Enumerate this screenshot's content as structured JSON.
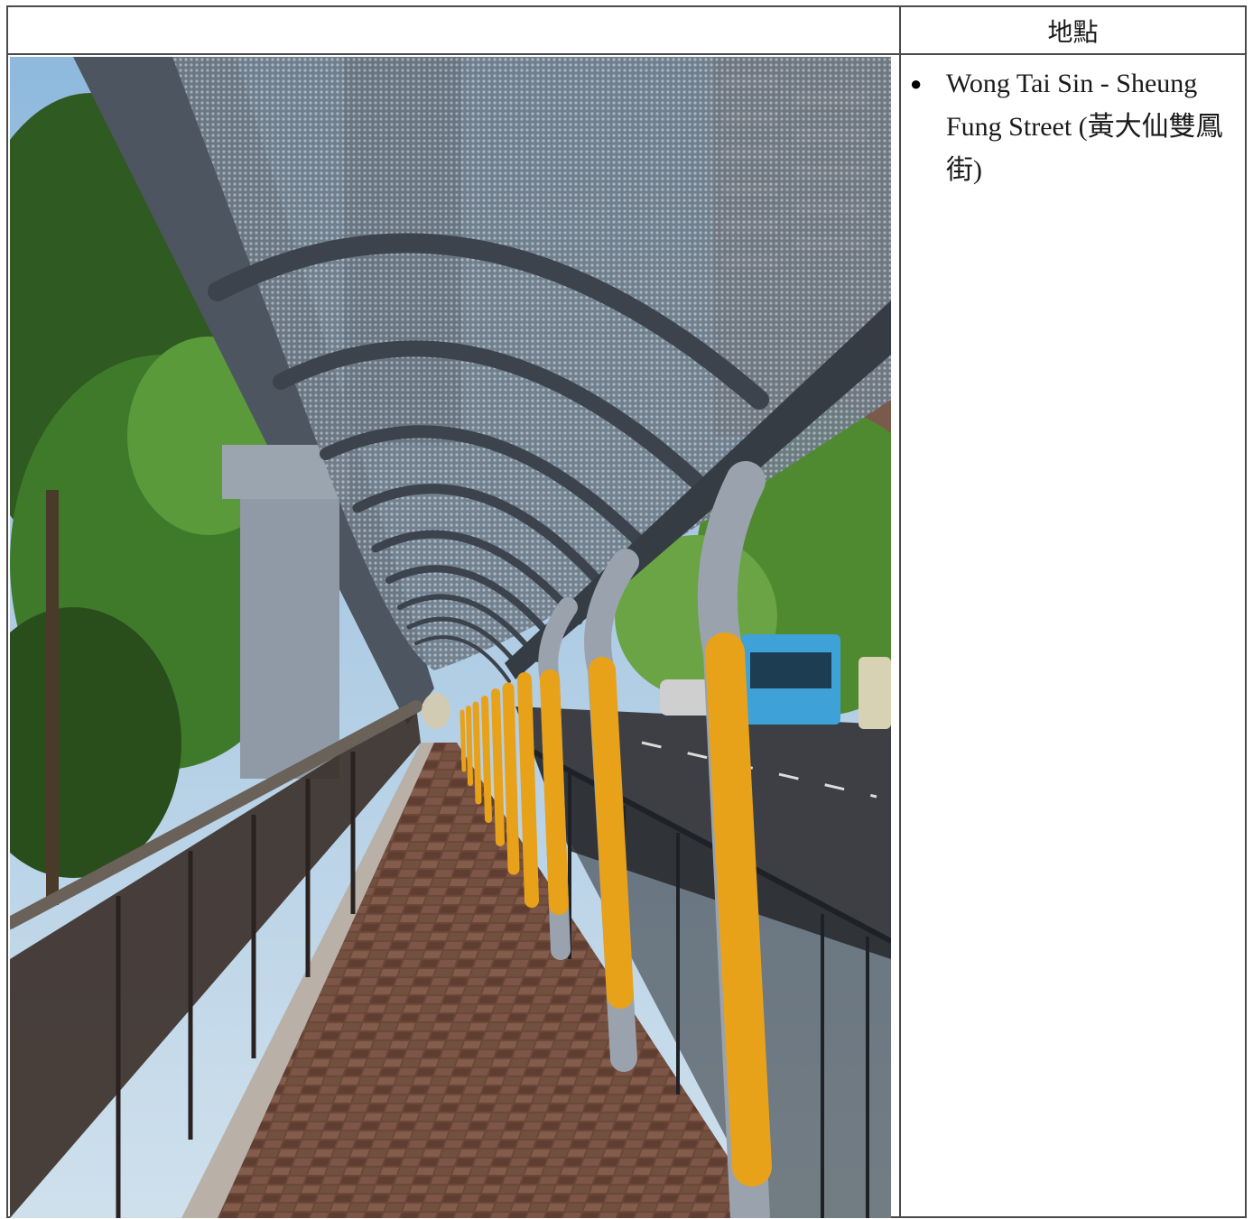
{
  "table": {
    "header_left": "",
    "header_right": "地點"
  },
  "photo": {
    "icon": "covered-walkway-photo"
  },
  "location": {
    "bullet_icon": "bullet-icon",
    "text": "Wong Tai Sin - Sheung Fung Street (黃大仙雙鳳街)"
  },
  "colors": {
    "border": "#4a4a4a",
    "column_yellow": "#e8a21a",
    "sky": "#6fa8d6",
    "foliage": "#3f7a2a"
  }
}
